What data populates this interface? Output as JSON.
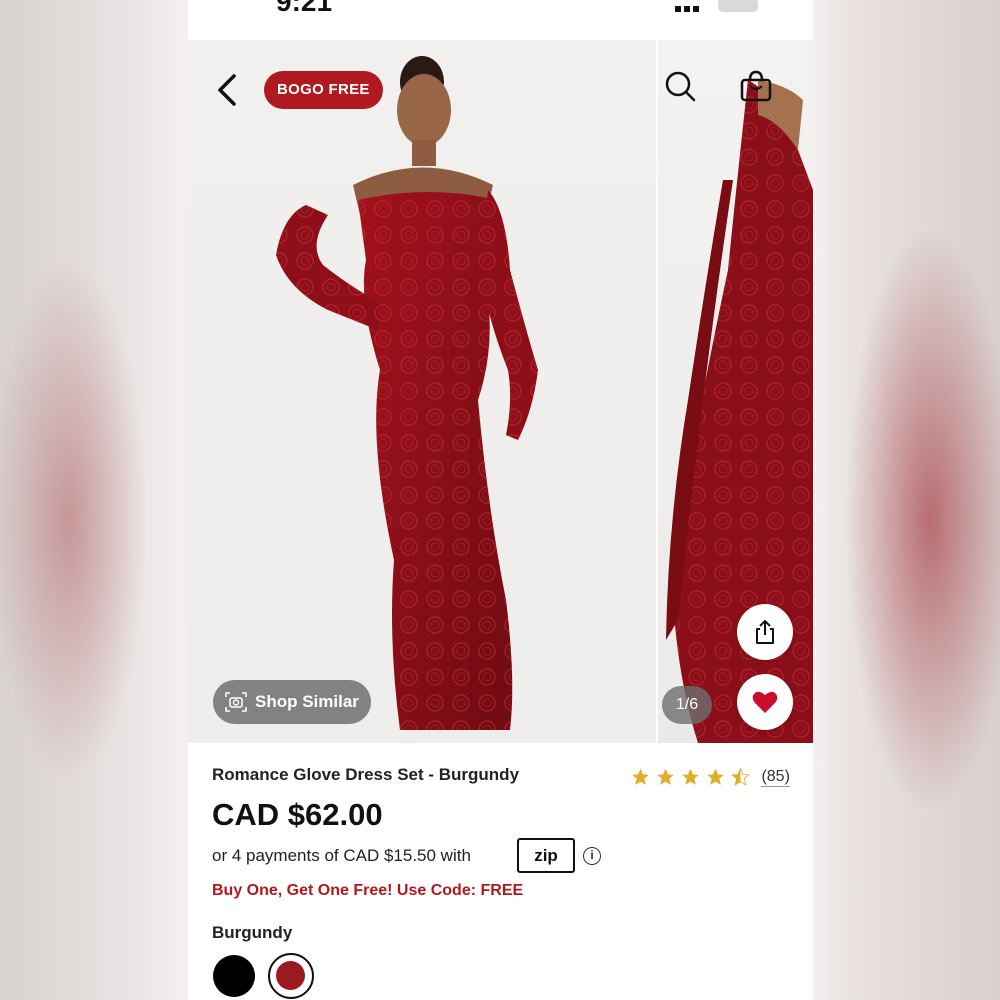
{
  "status_bar": {
    "time": "9:21"
  },
  "gallery": {
    "badge": "BOGO FREE",
    "shop_similar_label": "Shop Similar",
    "counter": "1/6",
    "icons": [
      "back-arrow-icon",
      "search-icon",
      "shopping-bag-icon",
      "camera-icon",
      "share-icon",
      "heart-icon"
    ]
  },
  "product": {
    "title": "Romance Glove Dress Set - Burgundy",
    "rating_stars": 4.5,
    "rating_count": "(85)",
    "price": "CAD $62.00",
    "installments_text": "or 4 payments of CAD $15.50 with",
    "zip_logo": "zip",
    "promo": "Buy One, Get One Free! Use Code: FREE",
    "color_label": "Burgundy",
    "colors": [
      "#000000",
      "#9b1a1f"
    ]
  },
  "colors": {
    "brand_red": "#b0191e",
    "star_gold": "#e2ac2a",
    "heart_red": "#c8102e"
  }
}
